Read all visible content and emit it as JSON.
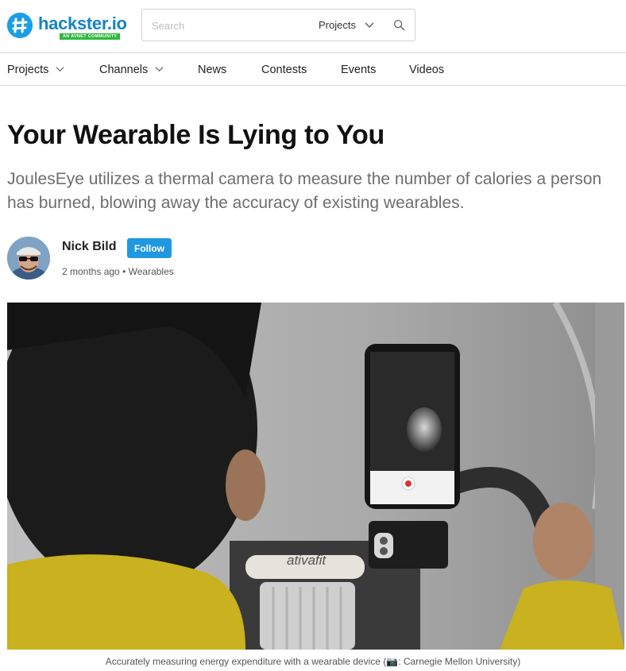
{
  "header": {
    "logo_text": "hackster.io",
    "logo_badge": "AN AVNET COMMUNITY",
    "search_placeholder": "Search",
    "search_scope": "Projects"
  },
  "nav": {
    "items": [
      {
        "label": "Projects",
        "has_dropdown": true
      },
      {
        "label": "Channels",
        "has_dropdown": true
      },
      {
        "label": "News",
        "has_dropdown": false
      },
      {
        "label": "Contests",
        "has_dropdown": false
      },
      {
        "label": "Events",
        "has_dropdown": false
      },
      {
        "label": "Videos",
        "has_dropdown": false
      }
    ]
  },
  "article": {
    "title": "Your Wearable Is Lying to You",
    "subtitle": "JoulesEye utilizes a thermal camera to measure the number of calories a person has burned, blowing away the accuracy of existing wearables.",
    "author": "Nick Bild",
    "follow_label": "Follow",
    "time_ago": "2 months ago",
    "separator": "•",
    "category": "Wearables",
    "caption_text": "Accurately measuring energy expenditure with a wearable device (",
    "caption_credit": ": Carnegie Mellon University)",
    "image_brand_label": "ativafit"
  },
  "colors": {
    "brand_blue": "#1a9fe6",
    "follow_blue": "#1f98e1",
    "badge_green": "#2db83d"
  }
}
